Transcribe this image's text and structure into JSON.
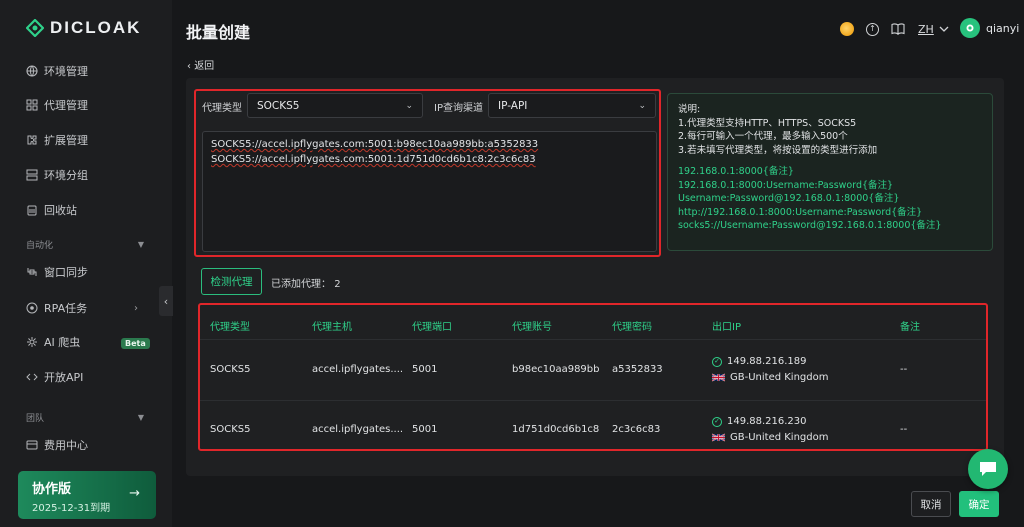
{
  "app": {
    "brand": "DICLOAK"
  },
  "sidebar": {
    "items": [
      {
        "label": "环境管理",
        "icon": "globe-icon"
      },
      {
        "label": "代理管理",
        "icon": "proxy-icon"
      },
      {
        "label": "扩展管理",
        "icon": "extension-icon"
      },
      {
        "label": "环境分组",
        "icon": "group-icon"
      },
      {
        "label": "回收站",
        "icon": "trash-icon"
      }
    ],
    "group_automation": "自动化",
    "automation_items": [
      {
        "label": "窗口同步",
        "icon": "sync-icon"
      },
      {
        "label": "RPA任务",
        "icon": "rpa-icon"
      },
      {
        "label": "AI 爬虫",
        "icon": "ai-icon",
        "badge": "Beta"
      },
      {
        "label": "开放API",
        "icon": "api-icon"
      }
    ],
    "group_team": "团队",
    "team_items": [
      {
        "label": "费用中心",
        "icon": "billing-icon"
      }
    ],
    "plan": {
      "title": "协作版",
      "expiry": "2025-12-31到期",
      "arrow": "→"
    }
  },
  "header": {
    "title": "批量创建",
    "language": "ZH",
    "username": "qianyi"
  },
  "back_link": "返回",
  "form": {
    "proxy_type_label": "代理类型",
    "proxy_type_value": "SOCKS5",
    "ip_channel_label": "IP查询渠道",
    "ip_channel_value": "IP-API",
    "proxy_lines": [
      "SOCKS5://accel.ipflygates.com:5001:b98ec10aa989bb:a5352833",
      "SOCKS5://accel.ipflygates.com:5001:1d751d0cd6b1c8:2c3c6c83"
    ]
  },
  "info": {
    "lines": [
      "说明:",
      "1.代理类型支持HTTP、HTTPS、SOCKS5",
      "2.每行可输入一个代理，最多输入500个",
      "3.若未填写代理类型，将按设置的类型进行添加"
    ],
    "examples": [
      "192.168.0.1:8000{备注}",
      "192.168.0.1:8000:Username:Password{备注}",
      "Username:Password@192.168.0.1:8000{备注}",
      "http://192.168.0.1:8000:Username:Password{备注}",
      "socks5://Username:Password@192.168.0.1:8000{备注}"
    ]
  },
  "actions": {
    "detect_label": "检测代理",
    "added_label": "已添加代理：",
    "added_count": "2"
  },
  "table": {
    "headers": [
      "代理类型",
      "代理主机",
      "代理端口",
      "代理账号",
      "代理密码",
      "出口IP",
      "备注"
    ],
    "rows": [
      {
        "type": "SOCKS5",
        "host": "accel.ipflygates....",
        "port": "5001",
        "account": "b98ec10aa989bb",
        "password": "a5352833",
        "ip": "149.88.216.189",
        "location": "GB-United Kingdom",
        "note": "--"
      },
      {
        "type": "SOCKS5",
        "host": "accel.ipflygates....",
        "port": "5001",
        "account": "1d751d0cd6b1c8",
        "password": "2c3c6c83",
        "ip": "149.88.216.230",
        "location": "GB-United Kingdom",
        "note": "--"
      }
    ]
  },
  "footer": {
    "cancel_label": "取消",
    "confirm_label": "确定"
  },
  "colors": {
    "accent": "#22c07c",
    "highlight": "#e0262a"
  }
}
